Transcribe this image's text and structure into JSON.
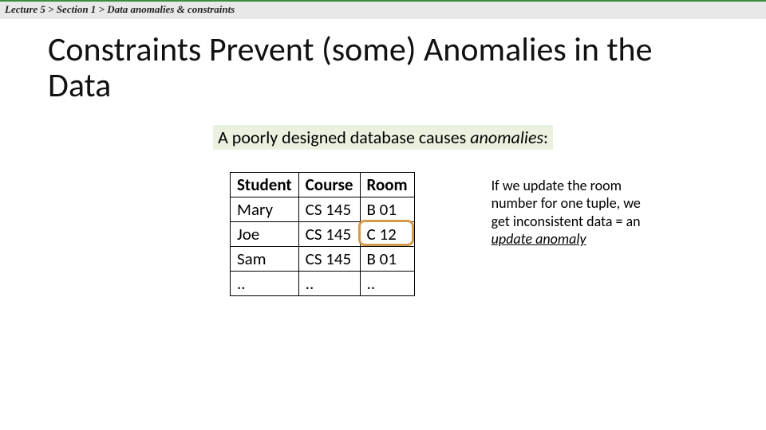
{
  "breadcrumb": {
    "lecture": "Lecture 5",
    "sep1": ">",
    "section": "Section 1",
    "sep2": ">",
    "topic": "Data anomalies & constraints"
  },
  "title": "Constraints Prevent (some) Anomalies in the Data",
  "subtitle_plain": "A poorly designed database causes ",
  "subtitle_em": "anomalies",
  "subtitle_tail": ":",
  "table": {
    "headers": [
      "Student",
      "Course",
      "Room"
    ],
    "rows": [
      [
        "Mary",
        "CS 145",
        "B 01"
      ],
      [
        "Joe",
        "CS 145",
        "C 12"
      ],
      [
        "Sam",
        "CS 145",
        "B 01"
      ],
      [
        "..",
        "..",
        ".."
      ]
    ],
    "highlight": {
      "row": 1,
      "col": 2
    }
  },
  "annotation": {
    "line": "If we update the room number for one tuple, we get inconsistent data = an ",
    "emph": "update anomaly"
  }
}
